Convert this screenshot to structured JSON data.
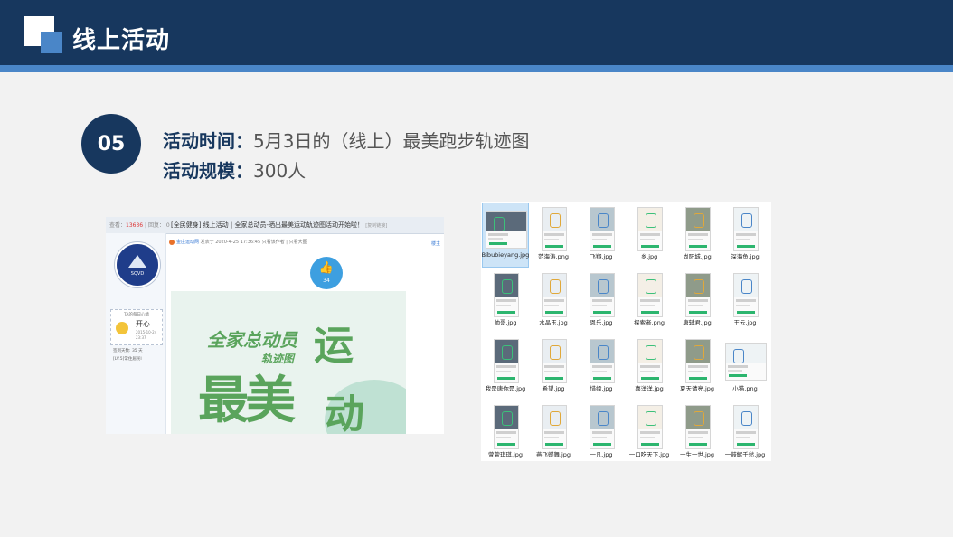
{
  "header": {
    "title": "线上活动"
  },
  "section": {
    "number": "05",
    "time_label": "活动时间：",
    "time_value": "5月3日的（线上）最美跑步轨迹图",
    "scale_label": "活动规模：",
    "scale_value": "300人"
  },
  "forum_screenshot": {
    "stats": [
      "查看：",
      "13636",
      "| 回复：",
      "0"
    ],
    "thread_title": "[全民健身] 线上活动 | 全家总动员-晒出最美运动轨迹图活动开始啦！",
    "thread_tag": "[复制链接]",
    "avatar_text": "SQVD",
    "author": "金庄运动网",
    "post_meta": "发表于 2020-4-25 17:36:45",
    "post_actions": "只看该作者 | 只看大图",
    "more_link": "楼主",
    "mood_title": "TA的每日心情",
    "mood": "开心",
    "mood_date": "2015-10-24 23:37",
    "side_meta": [
      "签到天数: 35 天",
      "[LV.5]常住居民I"
    ],
    "like_count": "34",
    "banner": {
      "line1": "全家总动员",
      "line2": "轨迹图",
      "char1": "运",
      "line3": "最美",
      "char2": "动"
    }
  },
  "file_explorer": {
    "files": [
      "Bibubieyang.jpg",
      "范海涛.png",
      "飞翔.jpg",
      "乡.jpg",
      "尚阳城.jpg",
      "深海鱼.jpg",
      "帅哥.jpg",
      "水晶玉.jpg",
      "恩乐.jpg",
      "探索者.png",
      "唐辅君.jpg",
      "王云.jpg",
      "我是唐你是.jpg",
      "希望.jpg",
      "惜缘.jpg",
      "嘉洋洋.jpg",
      "夏天请亮.jpg",
      "小猫.png",
      "萱萱琪琪.jpg",
      "燕飞蝶舞.jpg",
      "一凡.jpg",
      "一口吃天下.jpg",
      "一生一世.jpg",
      "一鼓解千愁.jpg"
    ],
    "selected_index": 0
  },
  "colors": {
    "navy": "#17375e",
    "accent": "#4a86c8",
    "green": "#5aa45c"
  }
}
